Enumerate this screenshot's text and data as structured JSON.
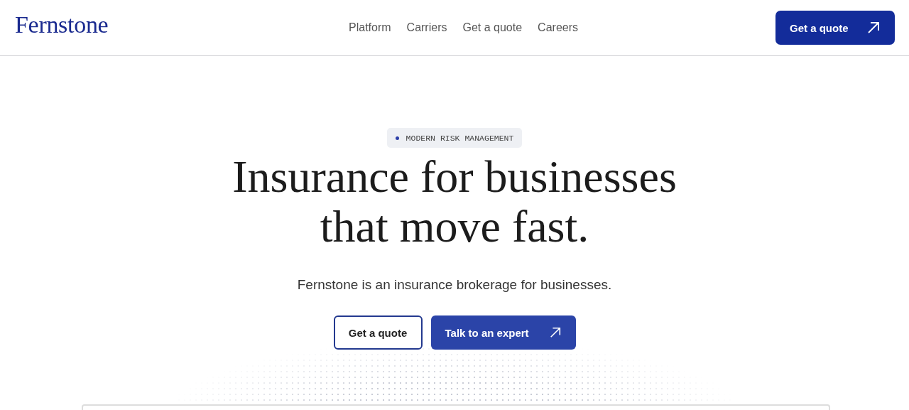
{
  "header": {
    "logo": "Fernstone",
    "nav": [
      {
        "label": "Platform"
      },
      {
        "label": "Carriers"
      },
      {
        "label": "Get a quote"
      },
      {
        "label": "Careers"
      }
    ],
    "cta": "Get a quote"
  },
  "hero": {
    "badge": "MODERN RISK MANAGEMENT",
    "title": "Insurance for businesses that move fast.",
    "subtitle": "Fernstone is an insurance brokerage for businesses.",
    "buttons": [
      {
        "label": "Get a quote",
        "kind": "outline"
      },
      {
        "label": "Talk to an expert",
        "kind": "solid"
      }
    ]
  }
}
